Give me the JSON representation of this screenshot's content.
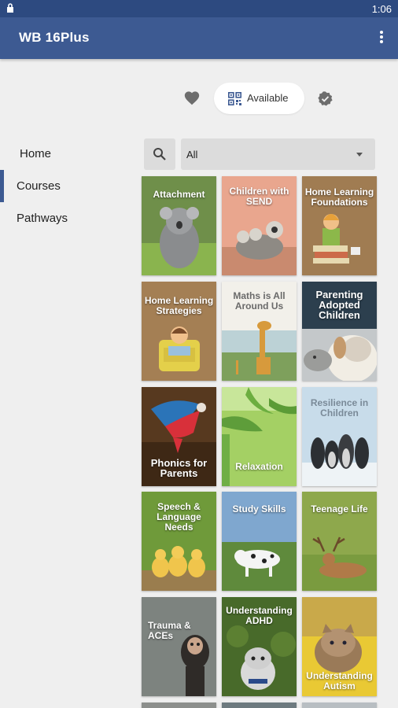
{
  "status_bar": {
    "time": "1:06"
  },
  "app_bar": {
    "title": "WB 16Plus"
  },
  "filters": {
    "available_label": "Available"
  },
  "sidebar": {
    "items": [
      {
        "label": "Home"
      },
      {
        "label": "Courses"
      },
      {
        "label": "Pathways"
      }
    ]
  },
  "search": {
    "selected": "All"
  },
  "courses": [
    {
      "title": "Attachment"
    },
    {
      "title": "Children with SEND"
    },
    {
      "title": "Home Learning Foundations"
    },
    {
      "title": "Home Learning Strategies"
    },
    {
      "title": "Maths is All Around Us"
    },
    {
      "title": "Parenting Adopted Children"
    },
    {
      "title": "Phonics for Parents"
    },
    {
      "title": "Relaxation"
    },
    {
      "title": "Resilience in Children"
    },
    {
      "title": "Speech & Language Needs"
    },
    {
      "title": "Study Skills"
    },
    {
      "title": "Teenage Life"
    },
    {
      "title": "Trauma & ACEs"
    },
    {
      "title": "Understanding ADHD"
    },
    {
      "title": "Understanding Autism"
    }
  ],
  "colors": {
    "app_bar": "#3d5a92",
    "status_bar": "#2d4a80",
    "active_indicator": "#3d5a92"
  }
}
